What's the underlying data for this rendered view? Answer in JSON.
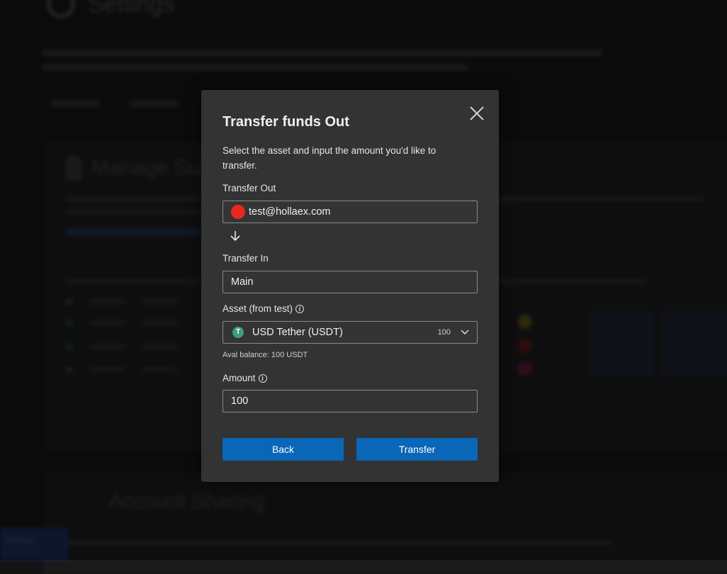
{
  "background": {
    "page_title": "Settings",
    "card1_title": "Manage Sub...",
    "card2_title": "Account Sharing",
    "side_tab": "Console"
  },
  "modal": {
    "title": "Transfer funds Out",
    "description": "Select the asset and input the amount you'd like to transfer.",
    "transfer_out": {
      "label": "Transfer Out",
      "value": "test@hollaex.com",
      "avatar_color": "#e8281e"
    },
    "arrow_icon": "arrow-down-icon",
    "transfer_in": {
      "label": "Transfer In",
      "value": "Main"
    },
    "asset": {
      "label": "Asset (from test)",
      "info_icon": "info-icon",
      "selected": "USD Tether (USDT)",
      "balance": "100",
      "icon": "tether-icon",
      "icon_color": "#3f9d7f",
      "icon_glyph": "T"
    },
    "aval_balance": "Aval balance: 100 USDT",
    "amount": {
      "label": "Amount",
      "info_icon": "info-icon",
      "value": "100"
    },
    "back_button": "Back",
    "transfer_button": "Transfer",
    "button_color": "#0a66b7",
    "close_icon": "close-icon"
  }
}
